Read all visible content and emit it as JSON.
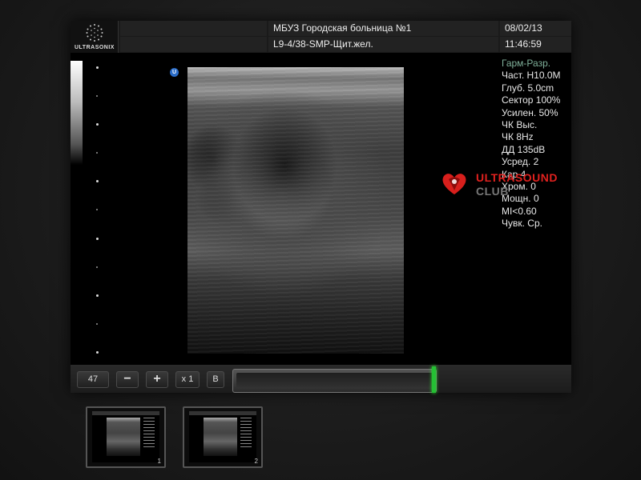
{
  "logo": {
    "text": "ULTRASONIX",
    "icon": "logo-ring-icon"
  },
  "header": {
    "institution": "МБУЗ Городская больница №1",
    "preset": "L9-4/38-SMP-Щит.жел.",
    "date": "08/02/13",
    "time": "11:46:59"
  },
  "orientation_marker": "U",
  "params": [
    "Гарм-Разр.",
    "Част. H10.0M",
    "Глуб. 5.0cm",
    "Сектор 100%",
    "Усилен. 50%",
    "ЧК Выс.",
    "ЧК 8Hz",
    "ДД 135dB",
    "Усред. 2",
    "Кар 4",
    "Хром. 0",
    "Мощн. 0",
    "MI<0.60",
    "Чувк. Ср."
  ],
  "watermark": {
    "line1": "ULTRASOUND",
    "line2": "CLUB",
    "icon": "ultrasound-club-logo-icon"
  },
  "toolbar": {
    "value": "47",
    "minus_label": "−",
    "plus_label": "+",
    "zoom_label": "x 1",
    "mode_label": "B"
  },
  "thumbnails": [
    {
      "number": "1"
    },
    {
      "number": "2"
    }
  ],
  "colors": {
    "accent_green": "#25c034",
    "params_highlight": "#7fb09a",
    "watermark_red": "#e0211e"
  }
}
